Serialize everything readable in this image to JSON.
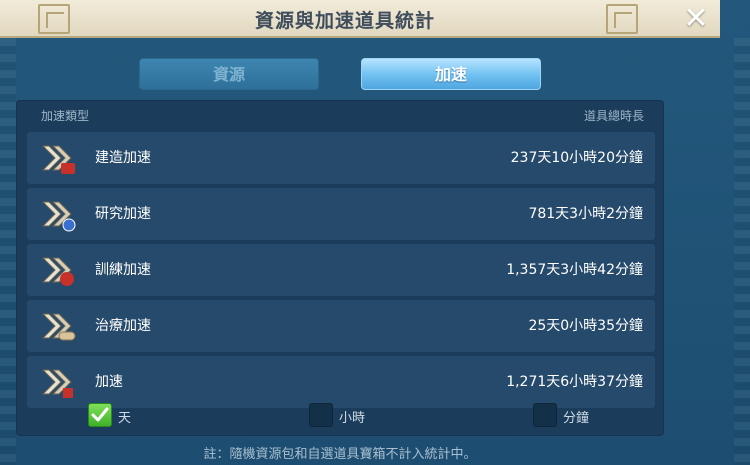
{
  "window": {
    "title": "資源與加速道具統計",
    "close_symbol": "✕"
  },
  "tabs": [
    {
      "label": "資源",
      "selected": false
    },
    {
      "label": "加速",
      "selected": true
    }
  ],
  "table": {
    "header_left": "加速類型",
    "header_right": "道具總時長",
    "rows": [
      {
        "label": "建造加速",
        "value": "237天10小時20分鐘",
        "badge_color": "#c8302a"
      },
      {
        "label": "研究加速",
        "value": "781天3小時2分鐘",
        "badge_color": "#3a6fd0"
      },
      {
        "label": "訓練加速",
        "value": "1,357天3小時42分鐘",
        "badge_color": "#c8302a"
      },
      {
        "label": "治療加速",
        "value": "25天0小時35分鐘",
        "badge_color": "#d9c39a"
      },
      {
        "label": "加速",
        "value": "1,271天6小時37分鐘",
        "badge_color": "#c8302a"
      }
    ]
  },
  "units": [
    {
      "label": "天",
      "checked": true
    },
    {
      "label": "小時",
      "checked": false
    },
    {
      "label": "分鐘",
      "checked": false
    }
  ],
  "footnote": "註：隨機資源包和自選道具寶箱不計入統計中。"
}
